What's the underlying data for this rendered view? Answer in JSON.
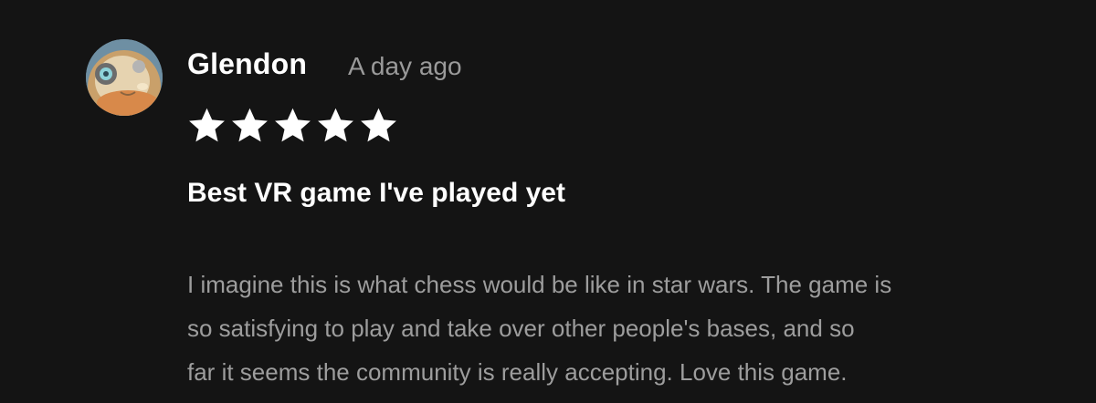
{
  "review": {
    "author": "Glendon",
    "timestamp": "A day ago",
    "rating": 5,
    "rating_max": 5,
    "title": "Best VR game I've played yet",
    "body_lines": [
      "I imagine this is what chess would be like in star wars. The game is",
      "so satisfying to play and take over other people's bases, and so",
      "far it seems the community is really accepting. Love this game."
    ]
  },
  "colors": {
    "background": "#141414",
    "text_primary": "#ffffff",
    "text_secondary": "#9a9a9a",
    "star_filled": "#ffffff"
  },
  "icons": {
    "avatar": "user-avatar",
    "star": "star-icon"
  }
}
